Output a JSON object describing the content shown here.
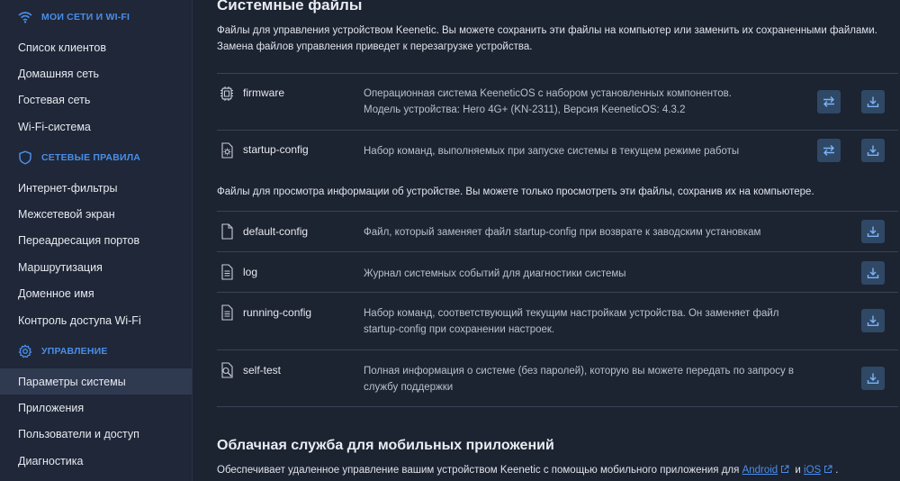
{
  "sidebar": {
    "sections": [
      {
        "title": "МОИ СЕТИ И WI-FI",
        "icon": "wifi-icon"
      },
      {
        "title": "СЕТЕВЫЕ ПРАВИЛА",
        "icon": "shield-icon"
      },
      {
        "title": "УПРАВЛЕНИЕ",
        "icon": "gear-icon"
      }
    ],
    "network_items": [
      "Список клиентов",
      "Домашняя сеть",
      "Гостевая сеть",
      "Wi-Fi-система"
    ],
    "rules_items": [
      "Интернет-фильтры",
      "Межсетевой экран",
      "Переадресация портов",
      "Маршрутизация",
      "Доменное имя",
      "Контроль доступа Wi-Fi"
    ],
    "management_items": [
      "Параметры системы",
      "Приложения",
      "Пользователи и доступ",
      "Диагностика"
    ],
    "active_item": "Параметры системы",
    "accent_color": "#4a8ee8"
  },
  "system_files": {
    "title": "Системные файлы",
    "description_line1": "Файлы для управления устройством Keenetic. Вы можете сохранить эти файлы на компьютер или заменить их сохраненными файлами.",
    "description_line2": "Замена файлов управления приведет к перезагрузке устройства.",
    "managed_files": [
      {
        "name": "firmware",
        "icon": "chip-icon",
        "desc1": "Операционная система KeeneticOS с набором установленных компонентов.",
        "desc2": "Модель устройства: Hero 4G+ (KN-2311), Версия KeeneticOS: 4.3.2"
      },
      {
        "name": "startup-config",
        "icon": "gear-file-icon",
        "desc1": "Набор команд, выполняемых при запуске системы в текущем режиме работы",
        "desc2": ""
      }
    ],
    "view_description": "Файлы для просмотра информации об устройстве. Вы можете только просмотреть эти файлы, сохранив их на компьютере.",
    "view_files": [
      {
        "name": "default-config",
        "icon": "file-icon",
        "desc1": "Файл, который заменяет файл startup-config при возврате к заводским установкам",
        "desc2": ""
      },
      {
        "name": "log",
        "icon": "file-lines-icon",
        "desc1": "Журнал системных событий для диагностики системы",
        "desc2": ""
      },
      {
        "name": "running-config",
        "icon": "file-lines-icon",
        "desc1": "Набор команд, соответствующий текущим настройкам устройства. Он заменяет файл",
        "desc2": "startup-config при сохранении настроек."
      },
      {
        "name": "self-test",
        "icon": "file-search-icon",
        "desc1": "Полная информация о системе (без паролей), которую вы можете передать по запросу в",
        "desc2": "службу поддержки"
      }
    ]
  },
  "cloud": {
    "title": "Облачная служба для мобильных приложений",
    "text_before": "Обеспечивает удаленное управление вашим устройством Keenetic с помощью мобильного приложения для",
    "link_android": "Android",
    "text_and": "и",
    "link_ios": "iOS",
    "text_end": "."
  }
}
